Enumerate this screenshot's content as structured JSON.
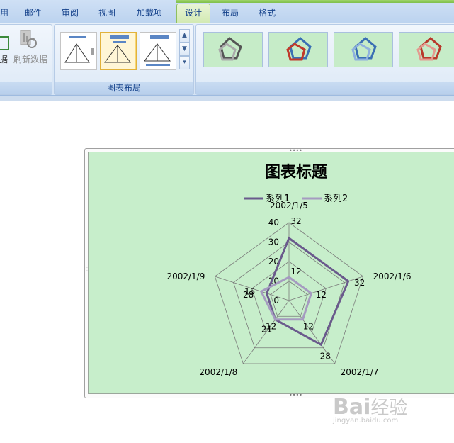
{
  "tabs": [
    {
      "label": "用",
      "active": false
    },
    {
      "label": "邮件",
      "active": false
    },
    {
      "label": "审阅",
      "active": false
    },
    {
      "label": "视图",
      "active": false
    },
    {
      "label": "加载项",
      "active": false
    },
    {
      "label": "设计",
      "active": true
    },
    {
      "label": "布局",
      "active": false
    },
    {
      "label": "格式",
      "active": false
    }
  ],
  "ribbon": {
    "data_group": {
      "select_data_partial": "据",
      "refresh_data": "刷新数据"
    },
    "layout_group": {
      "label": "图表布局"
    },
    "scroll": {
      "up": "▲",
      "down": "▼",
      "more": "▾"
    }
  },
  "colors": {
    "series1": "#6a5a8c",
    "series2": "#a59bc0",
    "chart_bg": "#c7eecb"
  },
  "chart_data": {
    "type": "radar",
    "title": "图表标题",
    "categories": [
      "2002/1/5",
      "2002/1/6",
      "2002/1/7",
      "2002/1/8",
      "2002/1/9"
    ],
    "series": [
      {
        "name": "系列1",
        "values": [
          32,
          32,
          28,
          12,
          12
        ]
      },
      {
        "name": "系列2",
        "values": [
          12,
          12,
          12,
          12,
          15
        ]
      }
    ],
    "axis_ticks": [
      0,
      10,
      20,
      30,
      40
    ],
    "ylim": [
      0,
      40
    ],
    "data_labels": {
      "2002/1/5": "32",
      "2002/1/6": "32",
      "2002/1/7": "28",
      "2002/1/8": "21",
      "2002/1/9": "28"
    },
    "inner_labels": [
      "12",
      "12",
      "12",
      "12",
      "15"
    ],
    "legend_position": "top"
  },
  "watermark": {
    "main": "Bai",
    "sub": "经验",
    "url": "jingyan.baidu.com"
  }
}
